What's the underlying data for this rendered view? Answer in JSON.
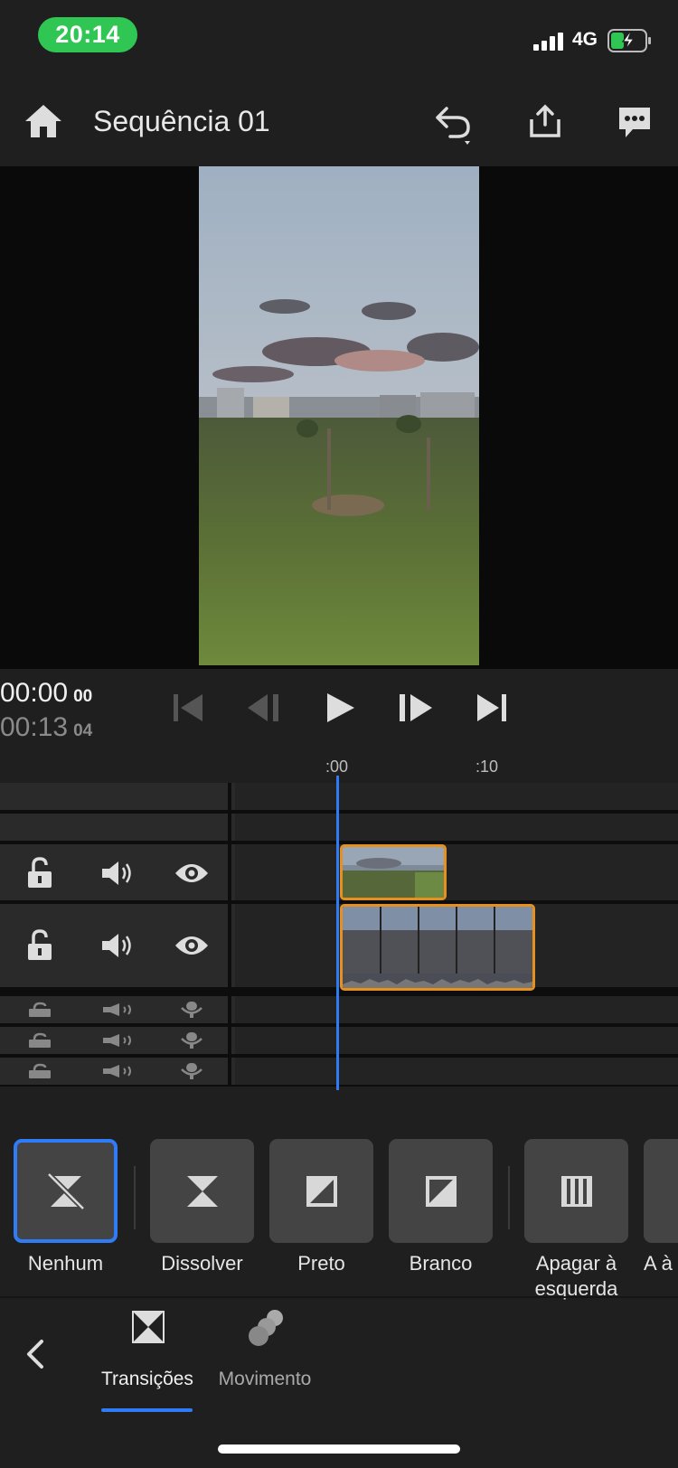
{
  "status_bar": {
    "time": "20:14",
    "network": "4G"
  },
  "header": {
    "title": "Sequência 01"
  },
  "playback": {
    "current_time": "00:00",
    "current_frames": "00",
    "duration_time": "00:13",
    "duration_frames": "04"
  },
  "ruler": {
    "marks": [
      ":00",
      ":10"
    ]
  },
  "transitions": [
    {
      "label": "Nenhum",
      "icon": "none-transition-icon",
      "selected": true
    },
    {
      "label": "Dissolver",
      "icon": "dissolve-icon",
      "selected": false
    },
    {
      "label": "Preto",
      "icon": "dip-black-icon",
      "selected": false
    },
    {
      "label": "Branco",
      "icon": "dip-white-icon",
      "selected": false
    },
    {
      "label": "Apagar à esquerda",
      "icon": "wipe-left-icon",
      "selected": false
    },
    {
      "label": "A à d",
      "icon": "wipe-icon",
      "selected": false
    }
  ],
  "bottom_tabs": {
    "transitions": "Transições",
    "motion": "Movimento"
  },
  "colors": {
    "accent_blue": "#2f7cf6",
    "clip_border": "#e6901f",
    "status_green": "#30c653"
  }
}
